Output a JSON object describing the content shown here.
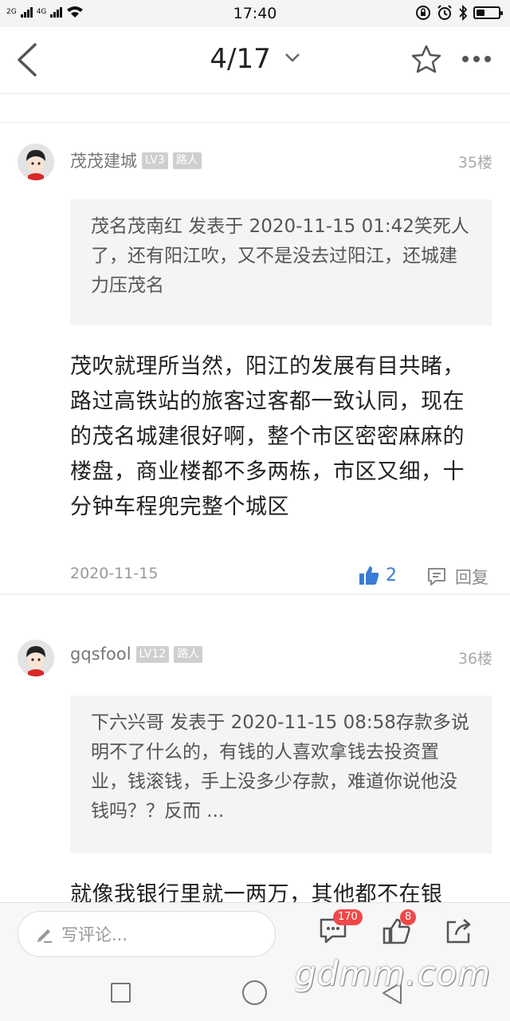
{
  "status_bar": {
    "network_1": "2G",
    "network_2": "4G",
    "time": "17:40"
  },
  "nav": {
    "page_indicator": "4/17"
  },
  "posts": [
    {
      "username": "茂茂建城",
      "level": "LV3",
      "role": "路人",
      "floor": "35楼",
      "quote": "茂名茂南红 发表于 2020-11-15 01:42笑死人了，还有阳江吹，又不是没去过阳江，还城建力压茂名",
      "content": "茂吹就理所当然，阳江的发展有目共睹，路过高铁站的旅客过客都一致认同，现在的茂名城建很好啊，整个市区密密麻麻的楼盘，商业楼都不多两栋，市区又细，十分钟车程兜完整个城区",
      "date": "2020-11-15",
      "likes": "2",
      "reply_label": "回复"
    },
    {
      "username": "gqsfool",
      "level": "LV12",
      "role": "路人",
      "floor": "36楼",
      "quote": "下六兴哥 发表于 2020-11-15 08:58存款多说明不了什么的，有钱的人喜欢拿钱去投资置业，钱滚钱，手上没多少存款，难道你说他没钱吗？？反而 ...",
      "content": "就像我银行里就一两万，其他都不在银"
    }
  ],
  "bottom_bar": {
    "comment_placeholder": "写评论...",
    "comment_count": "170",
    "like_count": "8"
  },
  "watermark": "gdmm.com",
  "colors": {
    "accent_blue": "#3a7bd5",
    "badge_red": "#f04848",
    "tag_grey": "#cfcfcf",
    "quote_bg": "#f4f4f4"
  }
}
